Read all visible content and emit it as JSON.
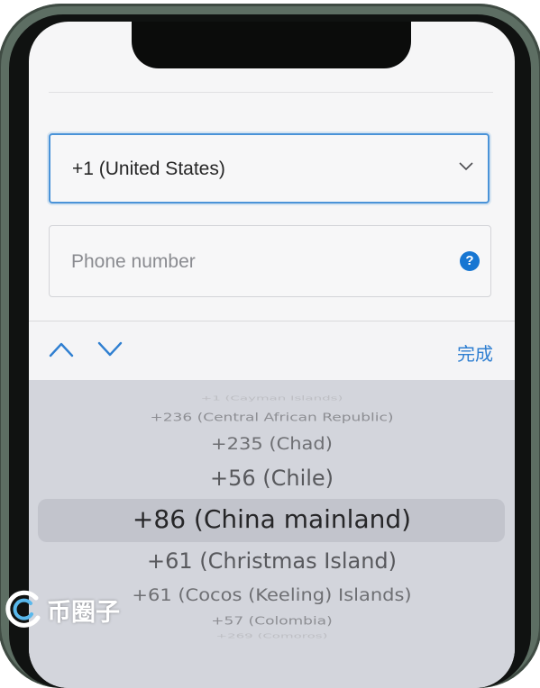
{
  "country_select": {
    "value": "+1 (United States)",
    "icon": "chevron-down-icon"
  },
  "phone_field": {
    "placeholder": "Phone number",
    "help_label": "?"
  },
  "toolbar": {
    "prev_icon": "chevron-up-icon",
    "next_icon": "chevron-down-icon",
    "done_label": "完成"
  },
  "picker": {
    "items": [
      "+1 (Cayman Islands)",
      "+236 (Central African Republic)",
      "+235 (Chad)",
      "+56 (Chile)",
      "+86 (China mainland)",
      "+61 (Christmas Island)",
      "+61 (Cocos (Keeling) Islands)",
      "+57 (Colombia)",
      "+269 (Comoros)"
    ],
    "selected_index": 4
  },
  "watermark": {
    "text": "币圈子"
  },
  "colors": {
    "accent": "#2f7fd1",
    "focus_border": "#4a93d8",
    "picker_bg": "#d3d5dc",
    "frame": "#5d6e63"
  }
}
